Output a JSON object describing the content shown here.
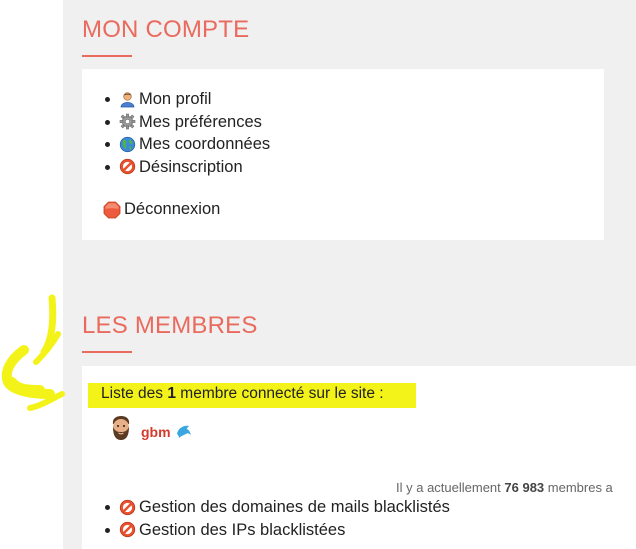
{
  "account": {
    "title": "MON COMPTE",
    "items": [
      {
        "label": "Mon profil",
        "icon": "user-icon"
      },
      {
        "label": "Mes préférences",
        "icon": "gear-icon"
      },
      {
        "label": "Mes coordonnées",
        "icon": "globe-icon"
      },
      {
        "label": "Désinscription",
        "icon": "forbidden-icon"
      }
    ],
    "logout": {
      "label": "Déconnexion",
      "icon": "stop-icon"
    }
  },
  "members": {
    "title": "LES MEMBRES",
    "online_prefix": "Liste des ",
    "online_count": "1",
    "online_suffix": " membre connecté sur le site :",
    "user": {
      "name": "gbm",
      "avatar": "bearded-avatar",
      "badge": "dolphin-icon"
    },
    "total_prefix": "Il y a actuellement ",
    "total_count": "76 983",
    "total_suffix": " membres a",
    "admin_items": [
      {
        "label": "Gestion des domaines de mails blacklistés",
        "icon": "forbidden-icon"
      },
      {
        "label": "Gestion des IPs blacklistées",
        "icon": "forbidden-icon"
      }
    ]
  },
  "colors": {
    "accent": "#ea6a5e",
    "highlight": "#f3f31a",
    "background": "#f0f0f0",
    "username": "#d33b2c"
  }
}
